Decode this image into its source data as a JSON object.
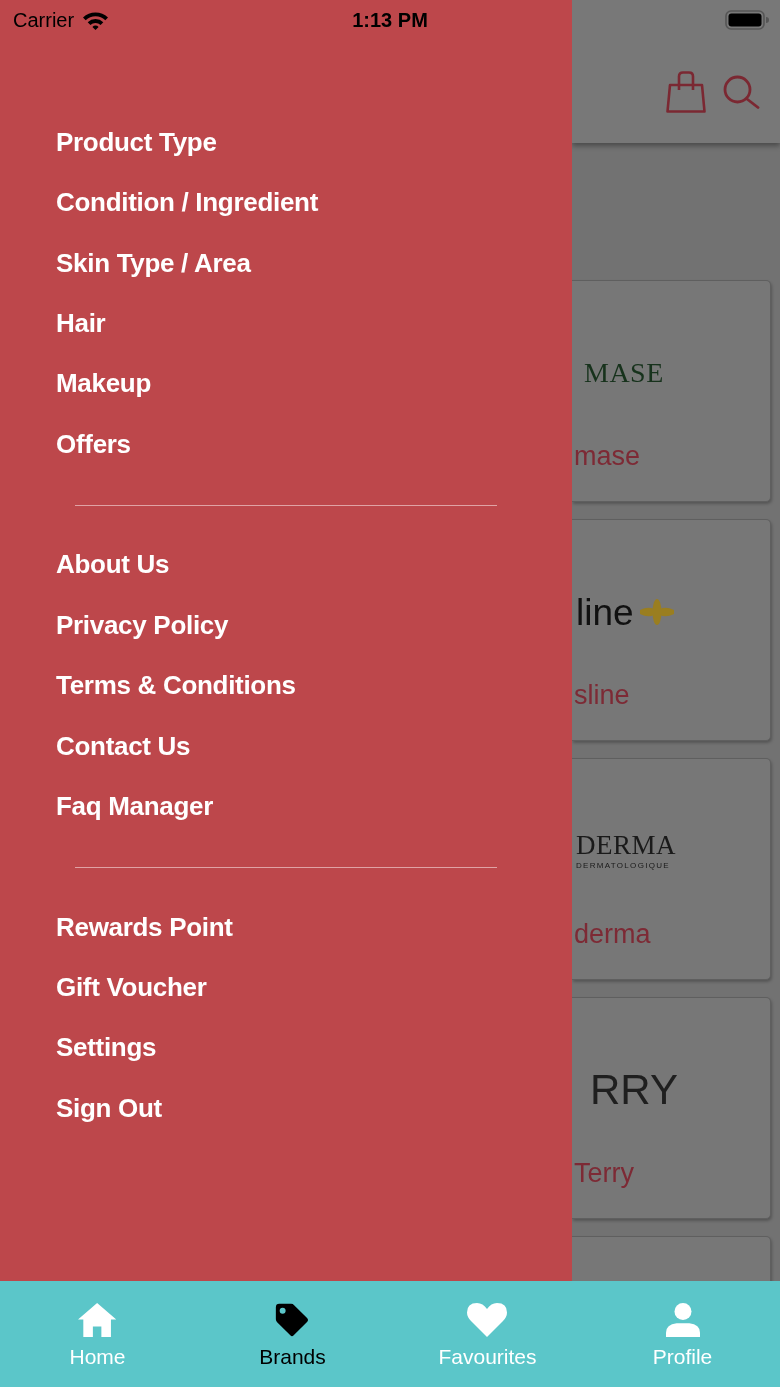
{
  "status_bar": {
    "carrier": "Carrier",
    "time": "1:13 PM"
  },
  "drawer": {
    "sections": [
      {
        "items": [
          "Product Type",
          "Condition / Ingredient",
          "Skin Type / Area",
          "Hair",
          "Makeup",
          "Offers"
        ]
      },
      {
        "items": [
          "About Us",
          "Privacy Policy",
          "Terms & Conditions",
          "Contact Us",
          "Faq Manager"
        ]
      },
      {
        "items": [
          "Rewards Point",
          "Gift Voucher",
          "Settings",
          "Sign Out"
        ]
      }
    ]
  },
  "brand_cards": [
    {
      "kind": "serif",
      "logo_text": "MASE",
      "name": "mase"
    },
    {
      "kind": "bee",
      "logo_text": "line",
      "name": "sline"
    },
    {
      "kind": "stacked",
      "logo_text": "DERMA",
      "logo_subtext": "DERMATOLOGIQUE",
      "name": "derma"
    },
    {
      "kind": "large",
      "logo_text": "RRY",
      "name": "Terry"
    },
    {
      "kind": "blank"
    }
  ],
  "tab_bar": [
    {
      "label": "Home",
      "selected": false
    },
    {
      "label": "Brands",
      "selected": true
    },
    {
      "label": "Favourites",
      "selected": false
    },
    {
      "label": "Profile",
      "selected": false
    }
  ]
}
